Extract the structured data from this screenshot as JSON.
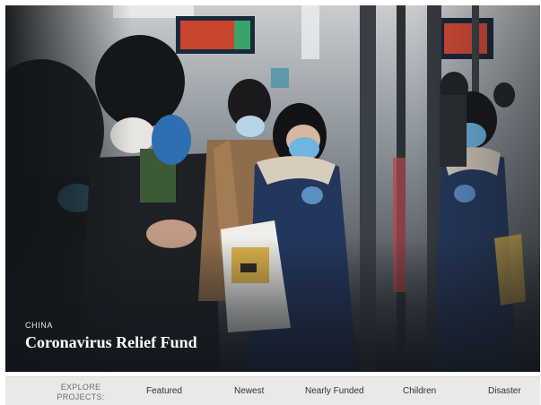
{
  "hero": {
    "eyebrow": "CHINA",
    "headline": "Coronavirus Relief Fund"
  },
  "explore": {
    "label_line1": "EXPLORE",
    "label_line2": "PROJECTS:",
    "items": [
      {
        "label": "Featured"
      },
      {
        "label": "Newest"
      },
      {
        "label": "Nearly Funded"
      },
      {
        "label": "Children"
      },
      {
        "label": "Disaster"
      }
    ]
  },
  "colors": {
    "bar_background": "#e9e9e7",
    "nav_text": "#2f3336",
    "label_text": "#6b6f73",
    "headline_text": "#ffffff"
  }
}
